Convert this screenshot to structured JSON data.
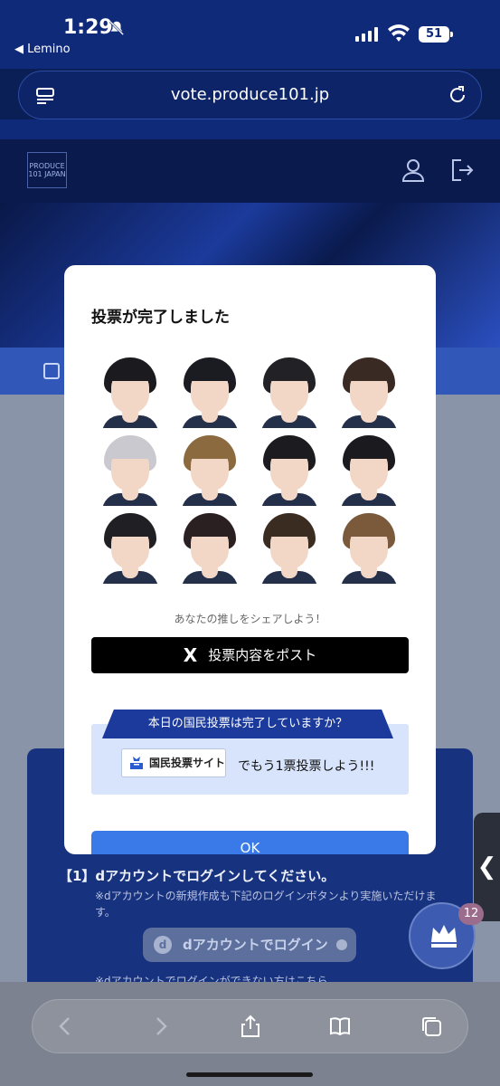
{
  "status_bar": {
    "time": "1:29",
    "back_app": "◀ Lemino",
    "battery": "51"
  },
  "browser": {
    "url": "vote.produce101.jp"
  },
  "site": {
    "logo_text": "PRODUCE 101 JAPAN"
  },
  "modal": {
    "title": "投票が完了しました",
    "share_caption": "あなたの推しをシェアしよう！",
    "post_label": "投票内容をポスト",
    "post_icon": "X",
    "promo_banner": "本日の国民投票は完了していますか？",
    "promo_site_label": "国民投票サイト",
    "promo_text": "でもう1票投票しよう!!!",
    "ok_label": "OK",
    "trainees": [
      {
        "hair": "#1a1a1f"
      },
      {
        "hair": "#1b1b22"
      },
      {
        "hair": "#222226"
      },
      {
        "hair": "#3a2a24"
      },
      {
        "hair": "#c9c9cf"
      },
      {
        "hair": "#8a6a3e"
      },
      {
        "hair": "#1c1c20"
      },
      {
        "hair": "#1a1a1f"
      },
      {
        "hair": "#202024"
      },
      {
        "hair": "#2a2022"
      },
      {
        "hair": "#3b2c22"
      },
      {
        "hair": "#7a5a3a"
      }
    ]
  },
  "background_page": {
    "step_label": "【1】dアカウントでログインしてください。",
    "note": "※dアカウントの新規作成も下記のログインボタンより実施いただけます。",
    "login_button": "dアカウントでログイン",
    "note2": "※dアカウントでログインができない方はこちら",
    "badge_count": "12"
  },
  "colors": {
    "accent": "#3a7ae8",
    "banner": "#1b3a9b",
    "header": "#102a7a"
  }
}
